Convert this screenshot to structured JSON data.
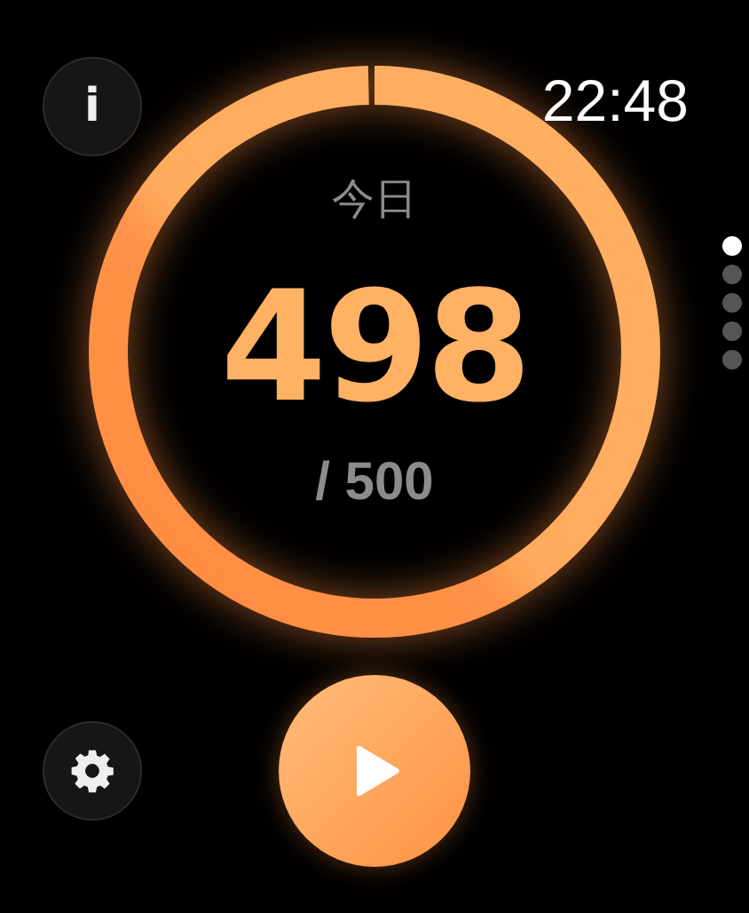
{
  "status_bar": {
    "time": "22:48"
  },
  "info_button": {
    "label": "i"
  },
  "progress": {
    "label": "今日",
    "count": "498",
    "goal": "/ 500",
    "level": 0.996
  },
  "page_dots": [
    {
      "selected": true
    },
    {
      "selected": false
    },
    {
      "selected": false
    },
    {
      "selected": false
    },
    {
      "selected": false
    }
  ],
  "controls": [
    {
      "kind": "settings"
    },
    {
      "kind": "play"
    }
  ]
}
